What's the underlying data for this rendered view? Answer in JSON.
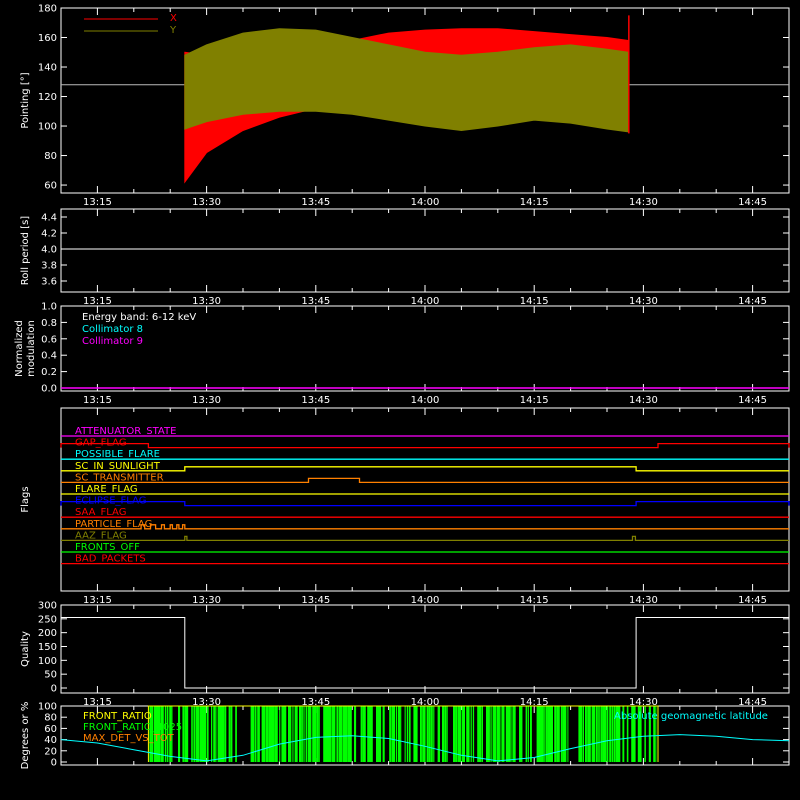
{
  "chart_data": [
    {
      "type": "line",
      "id": "pointing",
      "ylabel": "Pointing [°]",
      "ylim": [
        58,
        180
      ],
      "yticks": [
        "60",
        "80",
        "100",
        "120",
        "140",
        "160",
        "180"
      ],
      "xticks": [
        "13:15",
        "13:30",
        "13:45",
        "14:00",
        "14:15",
        "14:30",
        "14:45"
      ],
      "legend": [
        {
          "name": "X",
          "color": "#ff0000"
        },
        {
          "name": "Y",
          "color": "#808000"
        }
      ],
      "reference_line": 128,
      "series": [
        {
          "name": "X",
          "color": "#ff0000",
          "x": [
            "13:27",
            "13:30",
            "13:35",
            "13:40",
            "13:45",
            "13:50",
            "13:55",
            "14:00",
            "14:05",
            "14:10",
            "14:15",
            "14:20",
            "14:25",
            "14:28"
          ],
          "upper": [
            150,
            148,
            156,
            158,
            158,
            158,
            163,
            165,
            166,
            166,
            164,
            162,
            160,
            158
          ],
          "lower": [
            62,
            82,
            97,
            106,
            112,
            116,
            114,
            112,
            106,
            108,
            108,
            110,
            106,
            105
          ]
        },
        {
          "name": "Y",
          "color": "#808000",
          "x": [
            "13:27",
            "13:30",
            "13:35",
            "13:40",
            "13:45",
            "13:50",
            "13:55",
            "14:00",
            "14:05",
            "14:10",
            "14:15",
            "14:20",
            "14:25",
            "14:28"
          ],
          "upper": [
            148,
            155,
            163,
            166,
            165,
            160,
            155,
            150,
            148,
            150,
            153,
            155,
            152,
            150
          ],
          "lower": [
            98,
            103,
            108,
            110,
            110,
            108,
            104,
            100,
            97,
            100,
            104,
            102,
            98,
            96
          ]
        }
      ]
    },
    {
      "type": "line",
      "id": "roll",
      "ylabel": "Roll period [s]",
      "ylim": [
        3.5,
        4.5
      ],
      "yticks": [
        "3.6",
        "3.8",
        "4.0",
        "4.2",
        "4.4"
      ],
      "xticks": [
        "13:15",
        "13:30",
        "13:45",
        "14:00",
        "14:15",
        "14:30",
        "14:45"
      ],
      "series": [
        {
          "name": "",
          "color": "#ffffff",
          "x": [
            "13:10",
            "14:50"
          ],
          "y": [
            4.0,
            4.0
          ]
        }
      ]
    },
    {
      "type": "line",
      "id": "modulation",
      "ylabel": [
        "Normalized",
        "modulation"
      ],
      "ylim": [
        0,
        1
      ],
      "yticks": [
        "0.0",
        "0.2",
        "0.4",
        "0.6",
        "0.8",
        "1.0"
      ],
      "xticks": [
        "13:15",
        "13:30",
        "13:45",
        "14:00",
        "14:15",
        "14:30",
        "14:45"
      ],
      "legend": [
        {
          "name": "Energy band: 6-12 keV",
          "color": "#ffffff"
        },
        {
          "name": "Collimator 8",
          "color": "#00ffff"
        },
        {
          "name": "Collimator 9",
          "color": "#ff00ff"
        }
      ],
      "series": [
        {
          "name": "Collimator 9",
          "color": "#ff00ff",
          "x": [
            "13:10",
            "14:50"
          ],
          "y": [
            0.0,
            0.0
          ]
        }
      ]
    },
    {
      "type": "line",
      "id": "flags",
      "ylabel": "Flags",
      "xticks": [
        "13:15",
        "13:30",
        "13:45",
        "14:00",
        "14:15",
        "14:30",
        "14:45"
      ],
      "flags": [
        {
          "name": "ATTENUATOR_STATE",
          "color": "#ff00ff",
          "on": []
        },
        {
          "name": "GAP_FLAG",
          "color": "#ff0000",
          "on": [
            [
              "13:10",
              "13:22"
            ],
            [
              "14:32",
              "14:50"
            ]
          ]
        },
        {
          "name": "POSSIBLE_FLARE",
          "color": "#00ffff",
          "on": []
        },
        {
          "name": "SC_IN_SUNLIGHT",
          "color": "#ffff00",
          "on": [
            [
              "13:27",
              "14:29"
            ]
          ]
        },
        {
          "name": "SC_TRANSMITTER",
          "color": "#ff8000",
          "on": [
            [
              "13:44",
              "13:51"
            ]
          ]
        },
        {
          "name": "FLARE_FLAG",
          "color": "#ffff00",
          "on": []
        },
        {
          "name": "ECLIPSE_FLAG",
          "color": "#0000ff",
          "on": [
            [
              "13:10",
              "13:27"
            ],
            [
              "14:29",
              "14:50"
            ]
          ]
        },
        {
          "name": "SAA_FLAG",
          "color": "#ff0000",
          "on": []
        },
        {
          "name": "PARTICLE_FLAG",
          "color": "#ff8000",
          "on": [
            [
              "13:21",
              "13:21.5"
            ],
            [
              "13:22.3",
              "13:23"
            ],
            [
              "13:23.8",
              "13:24.2"
            ],
            [
              "13:25",
              "13:25.3"
            ],
            [
              "13:25.9",
              "13:26.2"
            ],
            [
              "13:26.7",
              "13:27"
            ]
          ]
        },
        {
          "name": "AAZ_FLAG",
          "color": "#808000",
          "on": [
            [
              "13:27",
              "13:27.3"
            ],
            [
              "14:28.5",
              "14:28.9"
            ]
          ]
        },
        {
          "name": "FRONTS_OFF",
          "color": "#00ff00",
          "on": []
        },
        {
          "name": "BAD_PACKETS",
          "color": "#ff0000",
          "on": []
        }
      ]
    },
    {
      "type": "line",
      "id": "quality",
      "ylabel": "Quality",
      "ylim": [
        0,
        300
      ],
      "yticks": [
        "0",
        "50",
        "100",
        "150",
        "200",
        "250",
        "300"
      ],
      "xticks": [
        "13:15",
        "13:30",
        "13:45",
        "14:00",
        "14:15",
        "14:30",
        "14:45"
      ],
      "series": [
        {
          "name": "",
          "color": "#ffffff",
          "x": [
            "13:10",
            "13:27",
            "13:27",
            "14:29",
            "14:29",
            "14:50"
          ],
          "y": [
            255,
            255,
            0,
            0,
            255,
            255
          ]
        }
      ]
    },
    {
      "type": "area",
      "id": "ratios",
      "ylabel": "Degrees or %",
      "ylim": [
        0,
        100
      ],
      "yticks": [
        "0",
        "20",
        "40",
        "60",
        "80",
        "100"
      ],
      "legend": [
        {
          "name": "FRONT_RATIO",
          "color": "#ffff00"
        },
        {
          "name": "FRONT_RATIO_1025",
          "color": "#00ff00"
        },
        {
          "name": "MAX_DET_VS_TOT",
          "color": "#ff8000"
        }
      ],
      "annotation": {
        "text": "Absolute geomagnetic latitude",
        "color": "#00ffff"
      },
      "front_ratio": {
        "x": [
          "13:22",
          "13:22",
          "14:32",
          "14:32"
        ],
        "y": [
          0,
          100,
          100,
          0
        ]
      },
      "front_ratio_1025_span": [
        "13:22",
        "14:32"
      ],
      "geomagnetic_latitude": {
        "x": [
          "13:10",
          "13:15",
          "13:20",
          "13:25",
          "13:30",
          "13:35",
          "13:40",
          "13:45",
          "13:50",
          "13:55",
          "14:00",
          "14:05",
          "14:10",
          "14:15",
          "14:20",
          "14:25",
          "14:30",
          "14:35",
          "14:40",
          "14:45",
          "14:50"
        ],
        "y": [
          40,
          34,
          22,
          10,
          2,
          12,
          32,
          44,
          47,
          42,
          28,
          12,
          2,
          8,
          24,
          38,
          46,
          49,
          46,
          40,
          38
        ]
      }
    }
  ]
}
